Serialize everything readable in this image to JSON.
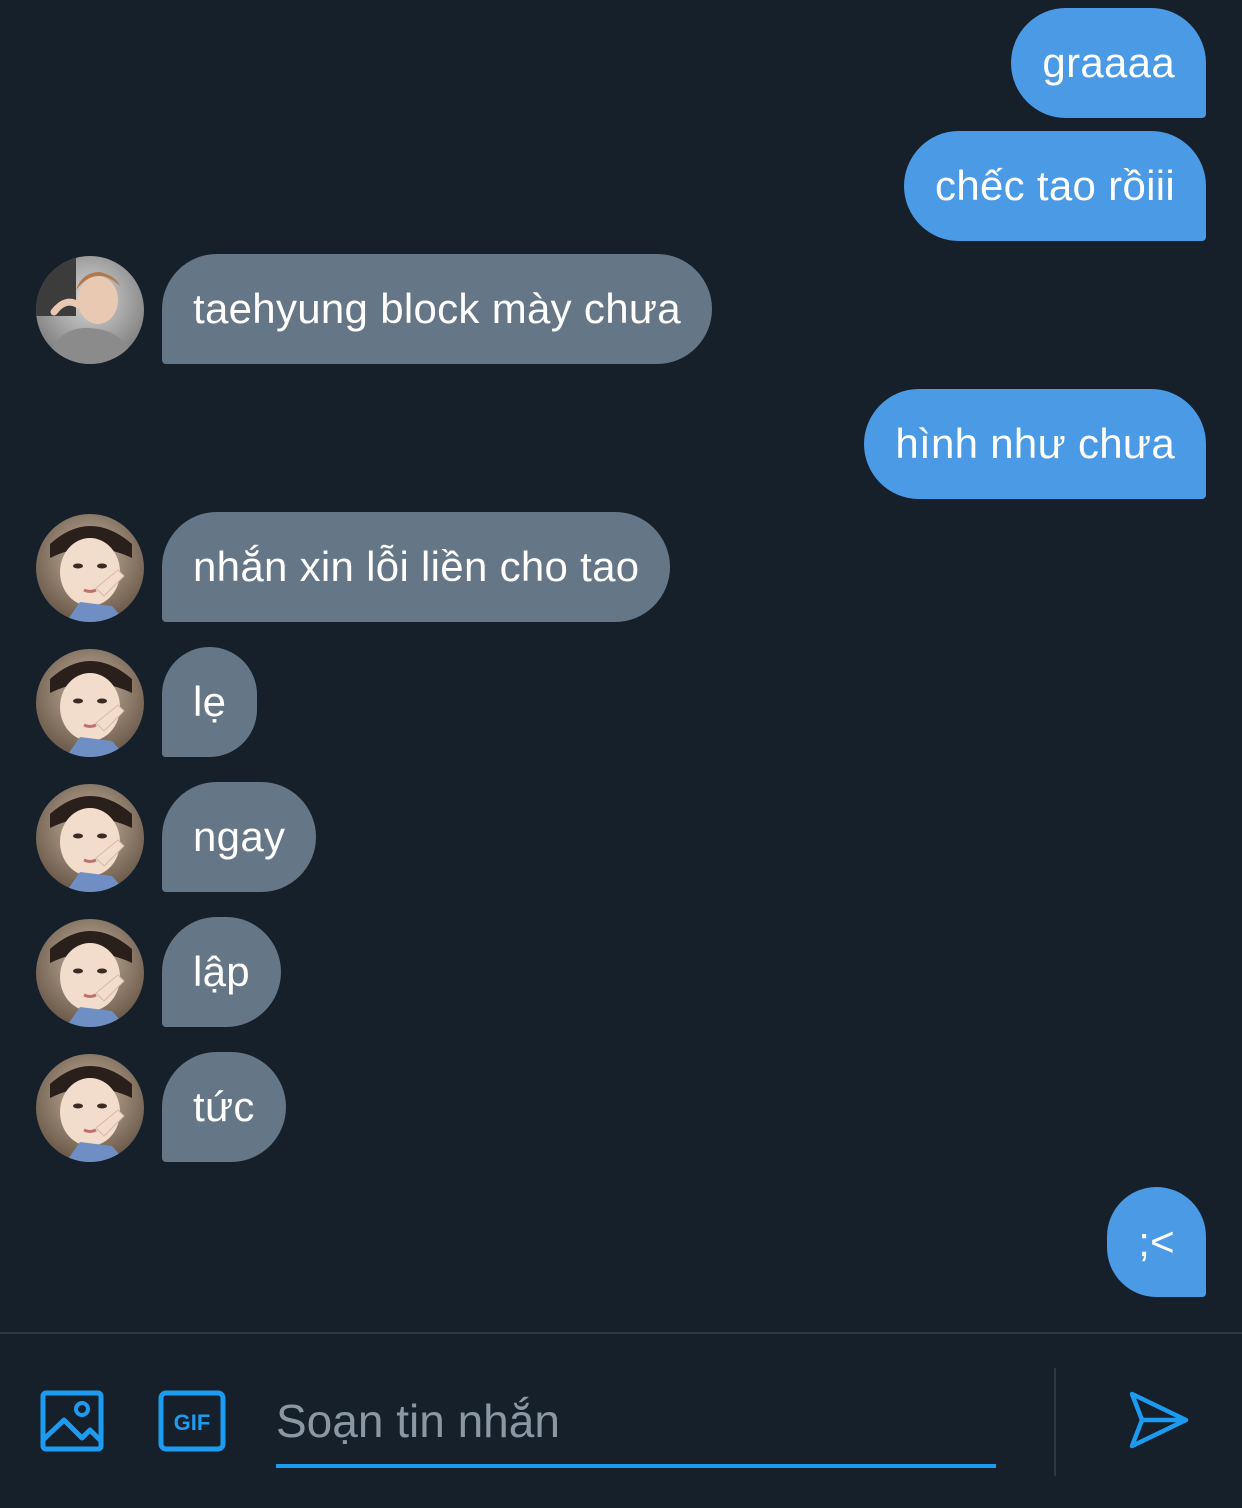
{
  "messages": [
    {
      "side": "out",
      "text": "graaaa"
    },
    {
      "side": "out",
      "text": "chếc tao rồiii"
    },
    {
      "side": "in",
      "text": "taehyung block mày chưa"
    },
    {
      "side": "out",
      "text": "hình như chưa"
    },
    {
      "side": "in",
      "text": "nhắn xin lỗi liền cho tao"
    },
    {
      "side": "in",
      "text": "lẹ"
    },
    {
      "side": "in",
      "text": "ngay"
    },
    {
      "side": "in",
      "text": "lập"
    },
    {
      "side": "in",
      "text": "tức"
    },
    {
      "side": "out",
      "text": ";<"
    }
  ],
  "composer": {
    "placeholder": "Soạn tin nhắn",
    "image_icon": "image-icon",
    "gif_icon": "gif-icon",
    "gif_label": "GIF",
    "send_icon": "send-icon"
  },
  "colors": {
    "background": "#16202b",
    "outgoing_bubble": "#4a9ae6",
    "incoming_bubble": "#657786",
    "accent": "#1d9bf0"
  }
}
